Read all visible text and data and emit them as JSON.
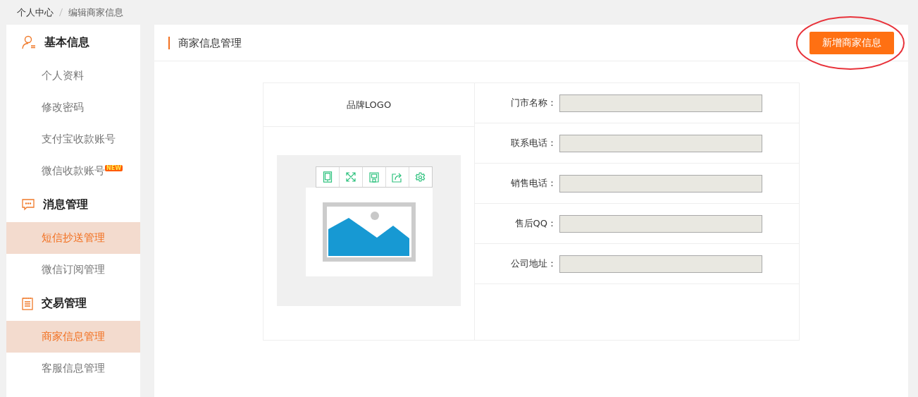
{
  "breadcrumb": [
    "个人中心",
    "编辑商家信息"
  ],
  "sidebar": {
    "groups": [
      {
        "title": "基本信息",
        "items": [
          {
            "label": "个人资料",
            "selected": false
          },
          {
            "label": "修改密码",
            "selected": false
          },
          {
            "label": "支付宝收款账号",
            "selected": false
          },
          {
            "label": "微信收款账号",
            "selected": false,
            "badge": "NEW"
          }
        ]
      },
      {
        "title": "消息管理",
        "items": [
          {
            "label": "短信抄送管理",
            "selected": true
          },
          {
            "label": "微信订阅管理",
            "selected": false
          }
        ]
      },
      {
        "title": "交易管理",
        "items": [
          {
            "label": "商家信息管理",
            "selected": true
          },
          {
            "label": "客服信息管理",
            "selected": false
          }
        ]
      }
    ]
  },
  "main": {
    "title": "商家信息管理",
    "add_button": "新增商家信息",
    "add_button_circled": true,
    "logo": {
      "label": "品牌LOGO"
    },
    "fields": [
      {
        "label": "门市名称："
      },
      {
        "label": "联系电话："
      },
      {
        "label": "销售电话："
      },
      {
        "label": "售后QQ："
      },
      {
        "label": "公司地址："
      }
    ]
  }
}
